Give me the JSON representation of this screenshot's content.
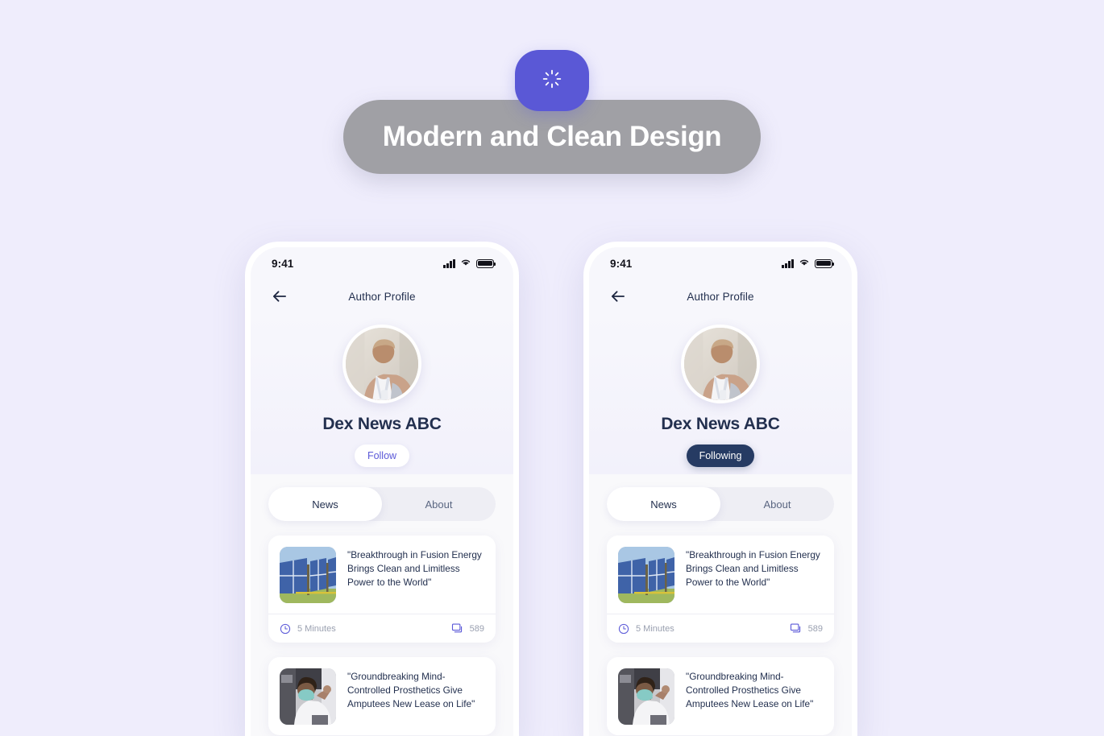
{
  "banner": {
    "text": "Modern and Clean Design",
    "badge_icon": "loading-spinner-icon",
    "badge_color": "#5a58d6",
    "pill_color": "#a0a0a5",
    "text_color": "#ffffff"
  },
  "page": {
    "background_color": "#efedfc"
  },
  "phones": [
    {
      "id": "phone-left",
      "status_bar": {
        "time": "9:41",
        "icons": [
          "cellular-signal-icon",
          "wifi-icon",
          "battery-icon"
        ]
      },
      "navbar": {
        "back_icon": "back-arrow-icon",
        "title": "Author Profile"
      },
      "profile": {
        "avatar_alt": "author-avatar",
        "name": "Dex News ABC",
        "follow_button": {
          "label": "Follow",
          "state": "not-following",
          "bg_color": "#ffffff",
          "text_color": "#5b59d8"
        }
      },
      "tabs": [
        {
          "label": "News",
          "active": true
        },
        {
          "label": "About",
          "active": false
        }
      ],
      "news": [
        {
          "thumb": "solar-panels-image",
          "title": "\"Breakthrough in Fusion Energy Brings Clean and Limitless Power to the World\"",
          "read_time": "5 Minutes",
          "read_time_icon": "clock-icon",
          "comments": "589",
          "comments_icon": "comment-icon"
        },
        {
          "thumb": "lab-researcher-image",
          "title": "\"Groundbreaking Mind-Controlled Prosthetics Give Amputees New Lease on Life\"",
          "read_time": "",
          "read_time_icon": "clock-icon",
          "comments": "",
          "comments_icon": "comment-icon"
        }
      ]
    },
    {
      "id": "phone-right",
      "status_bar": {
        "time": "9:41",
        "icons": [
          "cellular-signal-icon",
          "wifi-icon",
          "battery-icon"
        ]
      },
      "navbar": {
        "back_icon": "back-arrow-icon",
        "title": "Author Profile"
      },
      "profile": {
        "avatar_alt": "author-avatar",
        "name": "Dex News ABC",
        "follow_button": {
          "label": "Following",
          "state": "following",
          "bg_color": "#263b63",
          "text_color": "#ffffff"
        }
      },
      "tabs": [
        {
          "label": "News",
          "active": true
        },
        {
          "label": "About",
          "active": false
        }
      ],
      "news": [
        {
          "thumb": "solar-panels-image",
          "title": "\"Breakthrough in Fusion Energy Brings Clean and Limitless Power to the World\"",
          "read_time": "5 Minutes",
          "read_time_icon": "clock-icon",
          "comments": "589",
          "comments_icon": "comment-icon"
        },
        {
          "thumb": "lab-researcher-image",
          "title": "\"Groundbreaking Mind-Controlled Prosthetics Give Amputees New Lease on Life\"",
          "read_time": "",
          "read_time_icon": "clock-icon",
          "comments": "",
          "comments_icon": "comment-icon"
        }
      ]
    }
  ],
  "colors": {
    "accent_purple": "#5b59d8",
    "navy": "#23304f",
    "muted": "#9aa0b0"
  }
}
